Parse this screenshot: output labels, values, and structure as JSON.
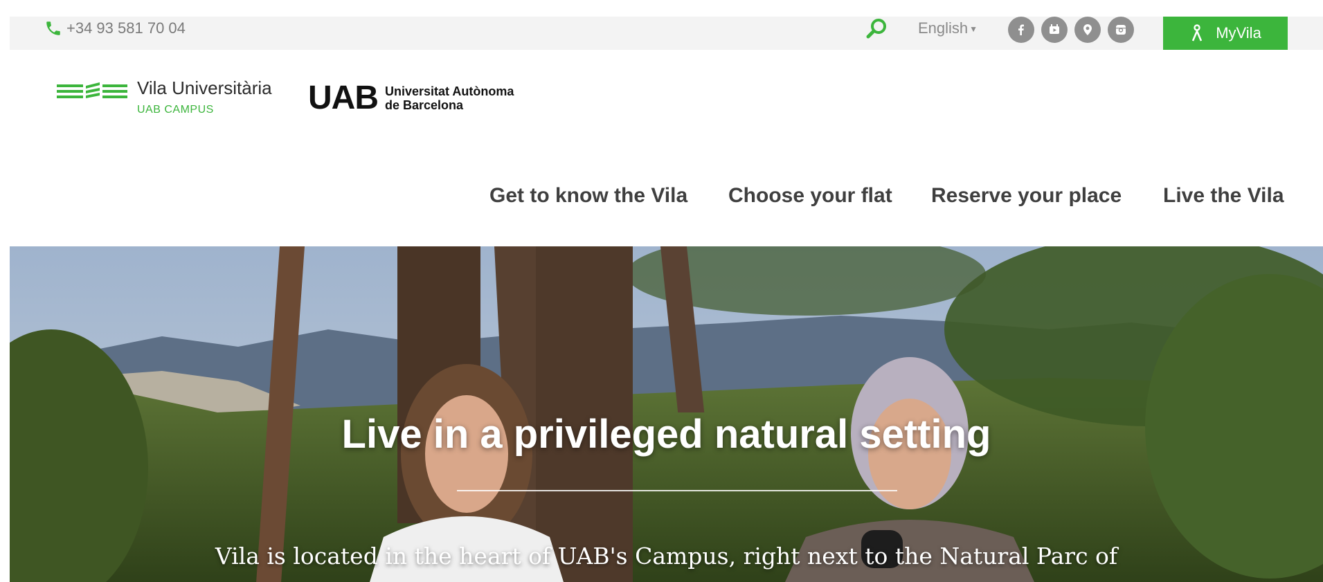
{
  "topbar": {
    "phone": "+34 93 581 70 04",
    "language": "English",
    "social_icons": [
      "facebook-icon",
      "youtube-icon",
      "location-pin-icon",
      "instagram-icon"
    ],
    "myvila_label": "MyVila"
  },
  "header": {
    "logo_vila_name": "Vila Universitària",
    "logo_vila_tagline": "UAB CAMPUS",
    "logo_uab_acronym": "UAB",
    "logo_uab_line1": "Universitat Autònoma",
    "logo_uab_line2": "de Barcelona"
  },
  "nav": {
    "items": [
      {
        "label": "Get to know the Vila"
      },
      {
        "label": "Choose your flat"
      },
      {
        "label": "Reserve your place"
      },
      {
        "label": "Live the Vila"
      }
    ]
  },
  "hero": {
    "title": "Live in a privileged natural setting",
    "subtitle": "Vila is located in the heart of UAB's Campus, right next to the Natural Parc of"
  },
  "colors": {
    "accent": "#3cb53c",
    "nav_text": "#3f3f3f",
    "utility_bar": "#f3f3f3"
  }
}
